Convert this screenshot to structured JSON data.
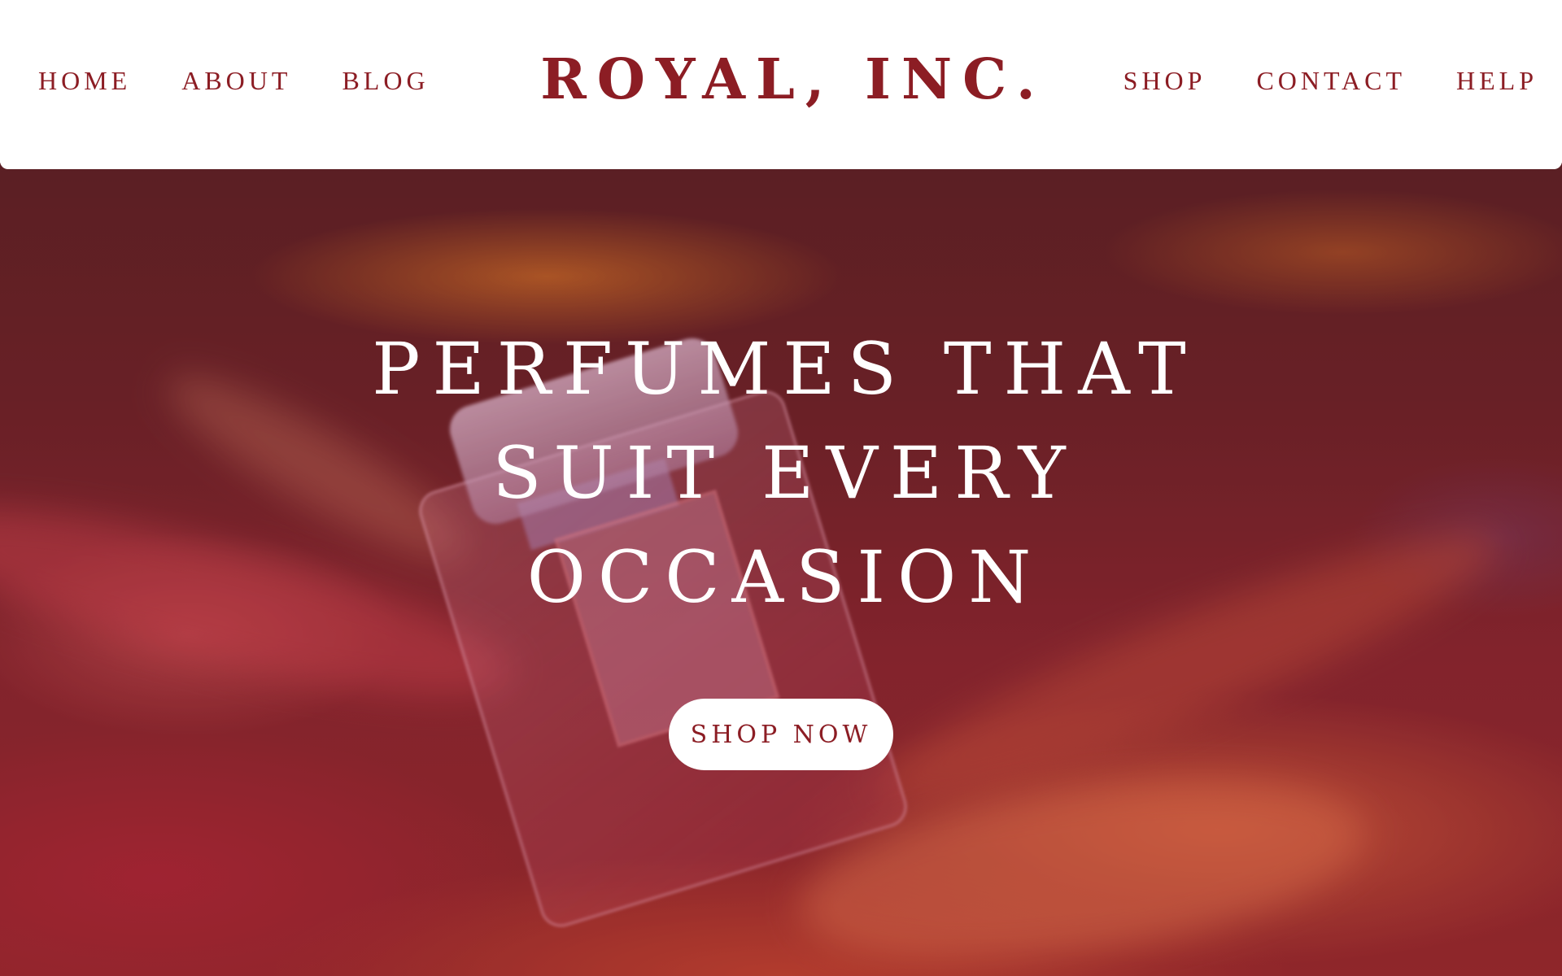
{
  "header": {
    "nav_left": [
      {
        "label": "HOME"
      },
      {
        "label": "ABOUT"
      },
      {
        "label": "BLOG"
      }
    ],
    "logo": "ROYAL, INC.",
    "nav_right": [
      {
        "label": "SHOP"
      },
      {
        "label": "CONTACT"
      },
      {
        "label": "HELP"
      }
    ]
  },
  "hero": {
    "headline_lines": [
      "PERFUMES THAT",
      "SUIT EVERY",
      "OCCASION"
    ],
    "cta_label": "SHOP NOW",
    "image_subject": "perfume-bottle-on-silk"
  },
  "colors": {
    "brand": "#8c1d24",
    "header_bg": "#ffffff",
    "cta_bg": "#ffffff",
    "headline": "#ffffff"
  }
}
